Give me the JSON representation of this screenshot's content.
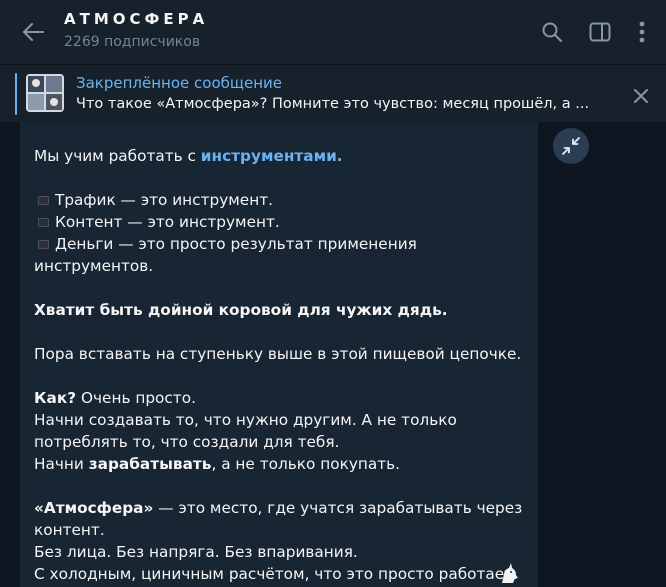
{
  "header": {
    "title": "АТМОСФЕРА",
    "subtitle": "2269 подписчиков",
    "icons": [
      "back-arrow-icon",
      "search-icon",
      "sidebar-toggle-icon",
      "more-vertical-icon"
    ]
  },
  "pinned": {
    "title": "Закреплённое сообщение",
    "text": "Что такое «Атмосфера»?  Помните это чувство: месяц прошёл, а ..."
  },
  "message": {
    "l1_plain": "Мы учим работать с ",
    "l1_link": "инструментами.",
    "b1": "Трафик — это инструмент.",
    "b2": "Контент — это инструмент.",
    "b3a": "Деньги — это просто результат применения",
    "b3b": "инструментов.",
    "bold1": "Хватит быть дойной коровой для чужих дядь.",
    "l5": "Пора вставать на ступеньку выше в этой пищевой цепочке.",
    "how_bold": "Как?",
    "how_rest": " Очень просто.",
    "l7a": "Начни создавать то, что нужно другим. А не только",
    "l7b": "потреблять то, что создали для тебя.",
    "l8_pre": "Начни ",
    "l8_bold": "зарабатывать",
    "l8_post": ", а не только покупать.",
    "atm_bold": "«Атмосфера»",
    "atm_rest": " — это место, где учатся зарабатывать через",
    "atm_rest2": "контент.",
    "l10": "Без лица. Без напряга. Без впаривания.",
    "l11": "С холодным, циничным расчётом, что это просто работает."
  },
  "colors": {
    "background": "#0e1621",
    "header": "#17212b",
    "bubble": "#182533",
    "accent": "#6ab3f3",
    "muted": "#708499"
  }
}
